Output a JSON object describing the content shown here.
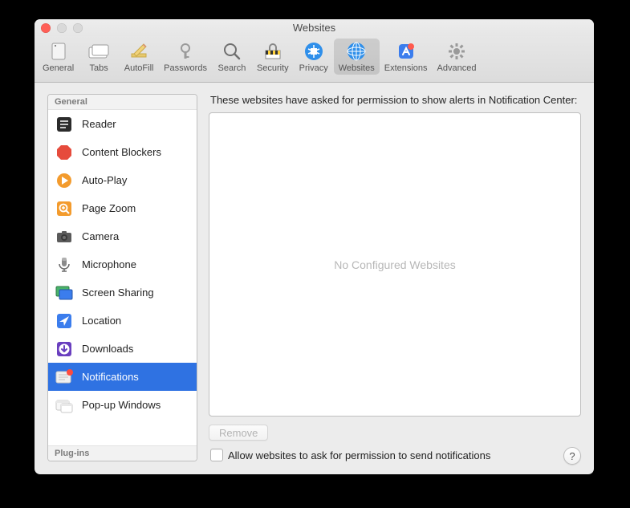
{
  "window": {
    "title": "Websites"
  },
  "toolbar": {
    "items": [
      {
        "id": "general",
        "label": "General"
      },
      {
        "id": "tabs",
        "label": "Tabs"
      },
      {
        "id": "autofill",
        "label": "AutoFill"
      },
      {
        "id": "passwords",
        "label": "Passwords"
      },
      {
        "id": "search",
        "label": "Search"
      },
      {
        "id": "security",
        "label": "Security"
      },
      {
        "id": "privacy",
        "label": "Privacy"
      },
      {
        "id": "websites",
        "label": "Websites"
      },
      {
        "id": "extensions",
        "label": "Extensions"
      },
      {
        "id": "advanced",
        "label": "Advanced"
      }
    ],
    "selected": "websites"
  },
  "sidebar": {
    "groups": [
      {
        "label": "General"
      },
      {
        "label": "Plug-ins"
      }
    ],
    "items": [
      {
        "label": "Reader"
      },
      {
        "label": "Content Blockers"
      },
      {
        "label": "Auto-Play"
      },
      {
        "label": "Page Zoom"
      },
      {
        "label": "Camera"
      },
      {
        "label": "Microphone"
      },
      {
        "label": "Screen Sharing"
      },
      {
        "label": "Location"
      },
      {
        "label": "Downloads"
      },
      {
        "label": "Notifications"
      },
      {
        "label": "Pop-up Windows"
      }
    ],
    "selected_index": 9
  },
  "detail": {
    "heading": "These websites have asked for permission to show alerts in Notification Center:",
    "empty_text": "No Configured Websites",
    "remove_label": "Remove",
    "checkbox_label": "Allow websites to ask for permission to send notifications",
    "checkbox_checked": false
  },
  "help_label": "?"
}
